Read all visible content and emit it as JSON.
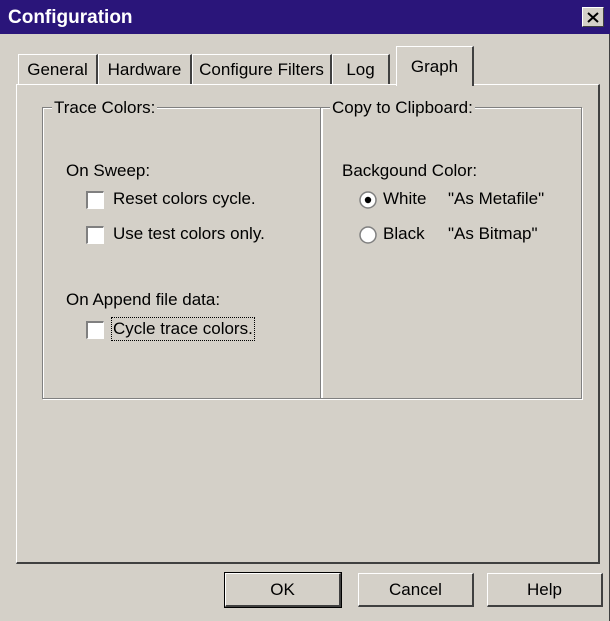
{
  "window": {
    "title": "Configuration"
  },
  "tabs": [
    {
      "label": "General"
    },
    {
      "label": "Hardware"
    },
    {
      "label": "Configure Filters"
    },
    {
      "label": "Log"
    },
    {
      "label": "Graph",
      "active": true
    }
  ],
  "trace_colors": {
    "title": "Trace Colors:",
    "on_sweep_label": "On Sweep:",
    "reset_colors": {
      "label": "Reset colors cycle.",
      "checked": false
    },
    "use_test_colors": {
      "label": "Use test colors only.",
      "checked": false
    },
    "on_append_label": "On Append file data:",
    "cycle_trace_colors": {
      "label": "Cycle trace colors.",
      "checked": false
    }
  },
  "clipboard": {
    "title": "Copy to Clipboard:",
    "background_label": "Backgound Color:",
    "options": [
      {
        "label": "White",
        "note": "\"As Metafile\"",
        "selected": true
      },
      {
        "label": "Black",
        "note": "\"As Bitmap\"",
        "selected": false
      }
    ]
  },
  "buttons": {
    "ok": "OK",
    "cancel": "Cancel",
    "help": "Help"
  },
  "colors": {
    "titlebar": "#2a157a",
    "face": "#d4d0c8"
  },
  "icons": {
    "close": "close-icon",
    "radio_selected": "radio-selected-icon",
    "radio_empty": "radio-empty-icon"
  }
}
